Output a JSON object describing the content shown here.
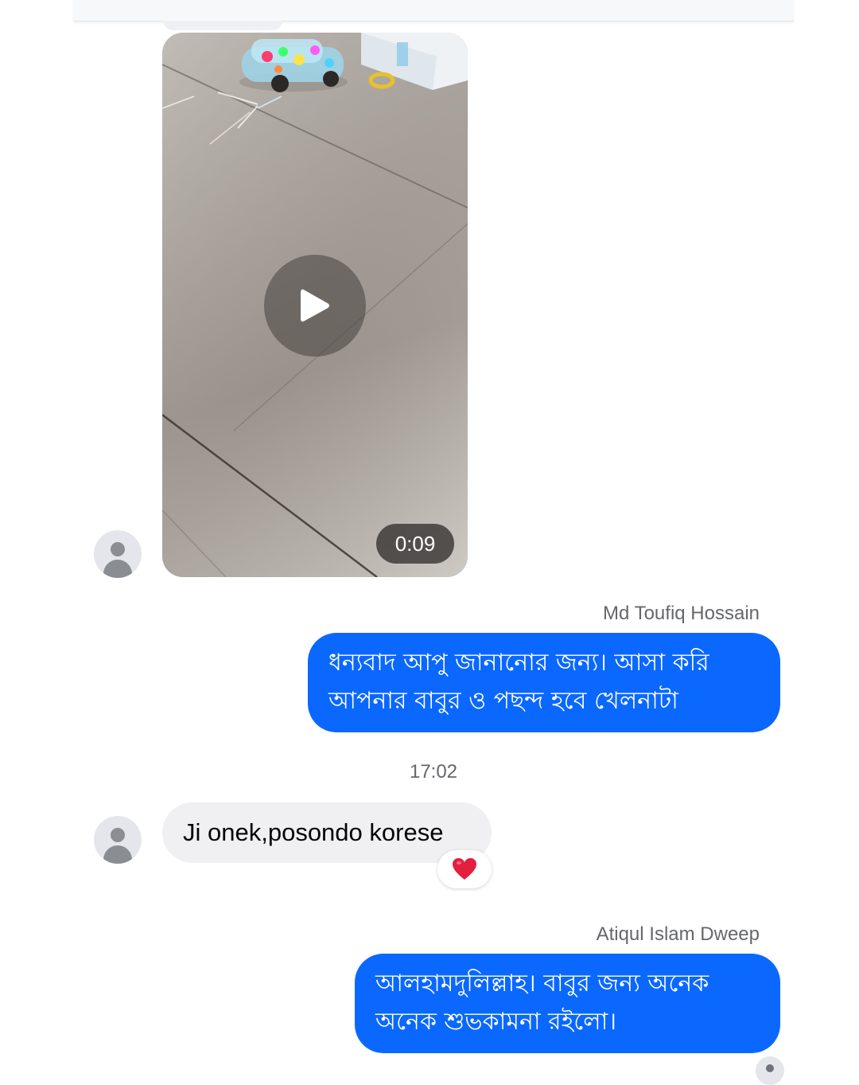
{
  "video": {
    "duration": "0:09"
  },
  "messages": [
    {
      "sender": "Md Toufiq Hossain",
      "text": "ধন্যবাদ আপু জানানোর জন্য। আসা করি আপনার বাবুর ও পছন্দ হবে খেলনাটা"
    },
    {
      "timestamp": "17:02"
    },
    {
      "text": "Ji onek,posondo korese",
      "reaction": "❤️"
    },
    {
      "sender": "Atiqul Islam Dweep",
      "text": "আলহামদুলিল্লাহ। বাবুর জন্য অনেক অনেক শুভকামনা রইলো।"
    }
  ],
  "colors": {
    "outgoing_bubble": "#0a68ff",
    "incoming_bubble": "#f0f0f2",
    "reaction_heart": "#e41e3f"
  },
  "icons": {
    "avatar": "default-profile-icon",
    "play": "play-icon",
    "reaction": "heart-icon"
  }
}
